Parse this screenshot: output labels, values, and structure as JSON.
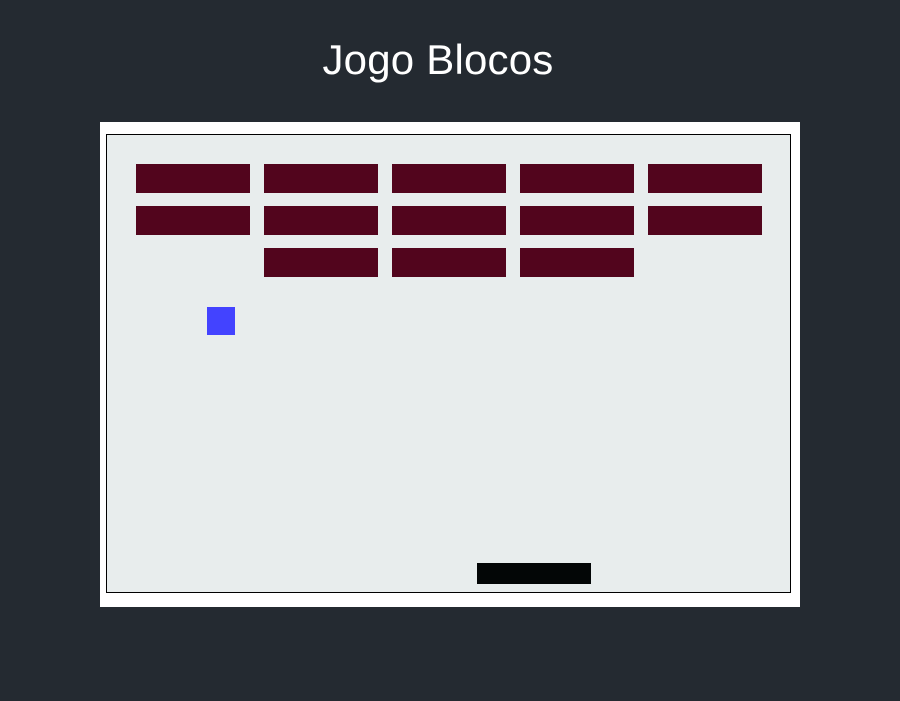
{
  "title": "Jogo Blocos",
  "game": {
    "brick_color": "#52051d",
    "ball_color": "#4343ff",
    "paddle_color": "#030606",
    "board_color": "#e8eded",
    "background_color": "#242a31",
    "brick_rows": [
      [
        1,
        1,
        1,
        1,
        1
      ],
      [
        1,
        1,
        1,
        1,
        1
      ],
      [
        0,
        1,
        1,
        1,
        0
      ]
    ]
  }
}
